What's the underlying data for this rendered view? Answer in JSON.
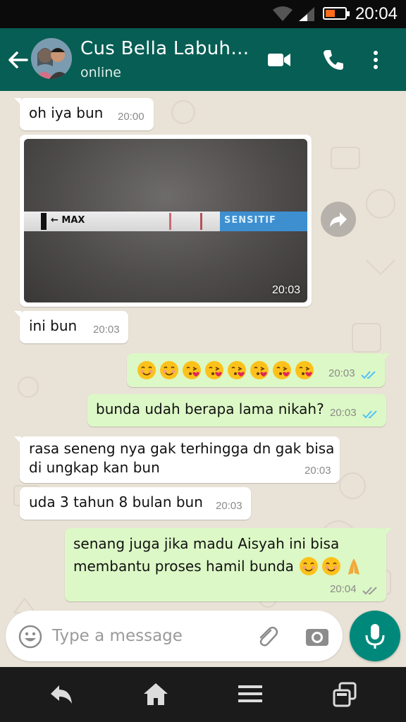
{
  "status_bar": {
    "time": "20:04",
    "battery_level": 0.5,
    "battery_color": "#ff6b1a"
  },
  "header": {
    "contact_name": "Cus Bella Labuh…",
    "status": "online",
    "color": "#075e54"
  },
  "colors": {
    "incoming": "#ffffff",
    "outgoing": "#dcf8c6",
    "read_tick": "#4fc3f7",
    "accent": "#00897b"
  },
  "messages": [
    {
      "dir": "in",
      "text": "oh iya bun",
      "time": "20:00"
    },
    {
      "dir": "in",
      "type": "image",
      "time": "20:03",
      "image_text": {
        "label_left": "← MAX",
        "label_right": "SENSITIF"
      }
    },
    {
      "dir": "in",
      "text": "ini bun",
      "time": "20:03"
    },
    {
      "dir": "out",
      "emojis": [
        "smiling-face",
        "smiling-face",
        "face-blowing-kiss",
        "face-blowing-kiss",
        "face-blowing-kiss",
        "face-blowing-kiss",
        "face-blowing-kiss",
        "face-blowing-kiss"
      ],
      "time": "20:03",
      "status": "read"
    },
    {
      "dir": "out",
      "text": "bunda udah berapa lama nikah?",
      "time": "20:03",
      "status": "read"
    },
    {
      "dir": "in",
      "text": "rasa seneng nya gak terhingga dn gak bisa\ndi ungkap kan bun",
      "time": "20:03"
    },
    {
      "dir": "in",
      "text": "uda 3 tahun 8 bulan bun",
      "time": "20:03"
    },
    {
      "dir": "out",
      "text": "senang juga jika madu Aisyah ini bisa\nmembantu proses hamil bunda",
      "trailing_emojis": [
        "smiling-face",
        "smiling-face",
        "folded-hands"
      ],
      "time": "20:04",
      "status": "delivered"
    }
  ],
  "composer": {
    "placeholder": "Type a message"
  },
  "nav": {
    "icons": [
      "back-icon",
      "home-icon",
      "menu-icon",
      "recent-apps-icon"
    ]
  }
}
